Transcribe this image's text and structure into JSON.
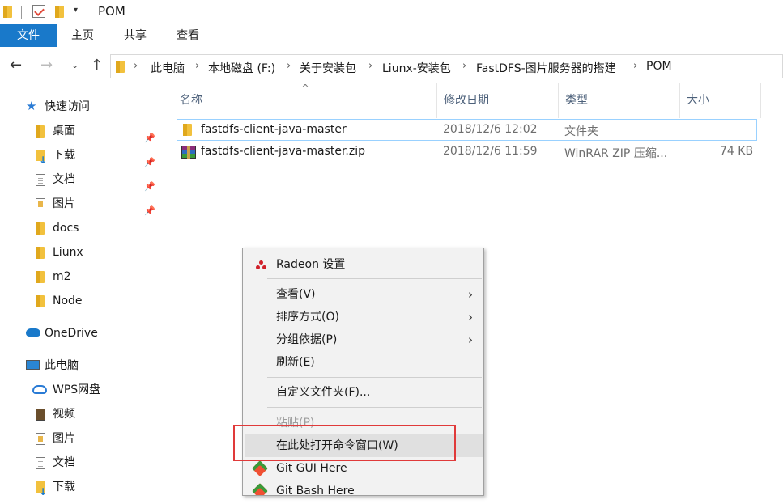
{
  "window": {
    "title": "POM",
    "quick_access_dropdown": "▾"
  },
  "ribbon": {
    "tabs": [
      "文件",
      "主页",
      "共享",
      "查看"
    ]
  },
  "nav": {
    "back": "←",
    "forward": "→",
    "recent": "⌄",
    "up": "↑",
    "breadcrumbs": [
      "此电脑",
      "本地磁盘 (F:)",
      "关于安装包",
      "Liunx-安装包",
      "FastDFS-图片服务器的搭建",
      "POM"
    ],
    "separator": "›"
  },
  "sidebar": {
    "quick_access": "快速访问",
    "pinned": [
      "桌面",
      "下载",
      "文档",
      "图片"
    ],
    "folders": [
      "docs",
      "Liunx",
      "m2",
      "Node"
    ],
    "onedrive": "OneDrive",
    "this_pc": "此电脑",
    "this_pc_items": [
      "WPS网盘",
      "视频",
      "图片",
      "文档",
      "下载"
    ],
    "pin_glyph": "📌"
  },
  "listview": {
    "columns": [
      "名称",
      "修改日期",
      "类型",
      "大小"
    ],
    "sort_caret": "^",
    "files": [
      {
        "name": "fastdfs-client-java-master",
        "modified": "2018/12/6 12:02",
        "type": "文件夹",
        "size": ""
      },
      {
        "name": "fastdfs-client-java-master.zip",
        "modified": "2018/12/6 11:59",
        "type": "WinRAR ZIP 压缩...",
        "size": "74 KB"
      }
    ]
  },
  "context_menu": {
    "items": [
      {
        "label": "Radeon 设置"
      },
      {
        "label": "查看(V)",
        "submenu": "›"
      },
      {
        "label": "排序方式(O)",
        "submenu": "›"
      },
      {
        "label": "分组依据(P)",
        "submenu": "›"
      },
      {
        "label": "刷新(E)"
      },
      {
        "label": "自定义文件夹(F)..."
      },
      {
        "label": "粘贴(P)"
      },
      {
        "label": "在此处打开命令窗口(W)"
      },
      {
        "label": "Git GUI Here"
      },
      {
        "label": "Git Bash Here"
      }
    ],
    "highlight_color": "#e03a3a"
  },
  "colors": {
    "accent": "#1979ca",
    "selection_border": "#99d1ff"
  }
}
